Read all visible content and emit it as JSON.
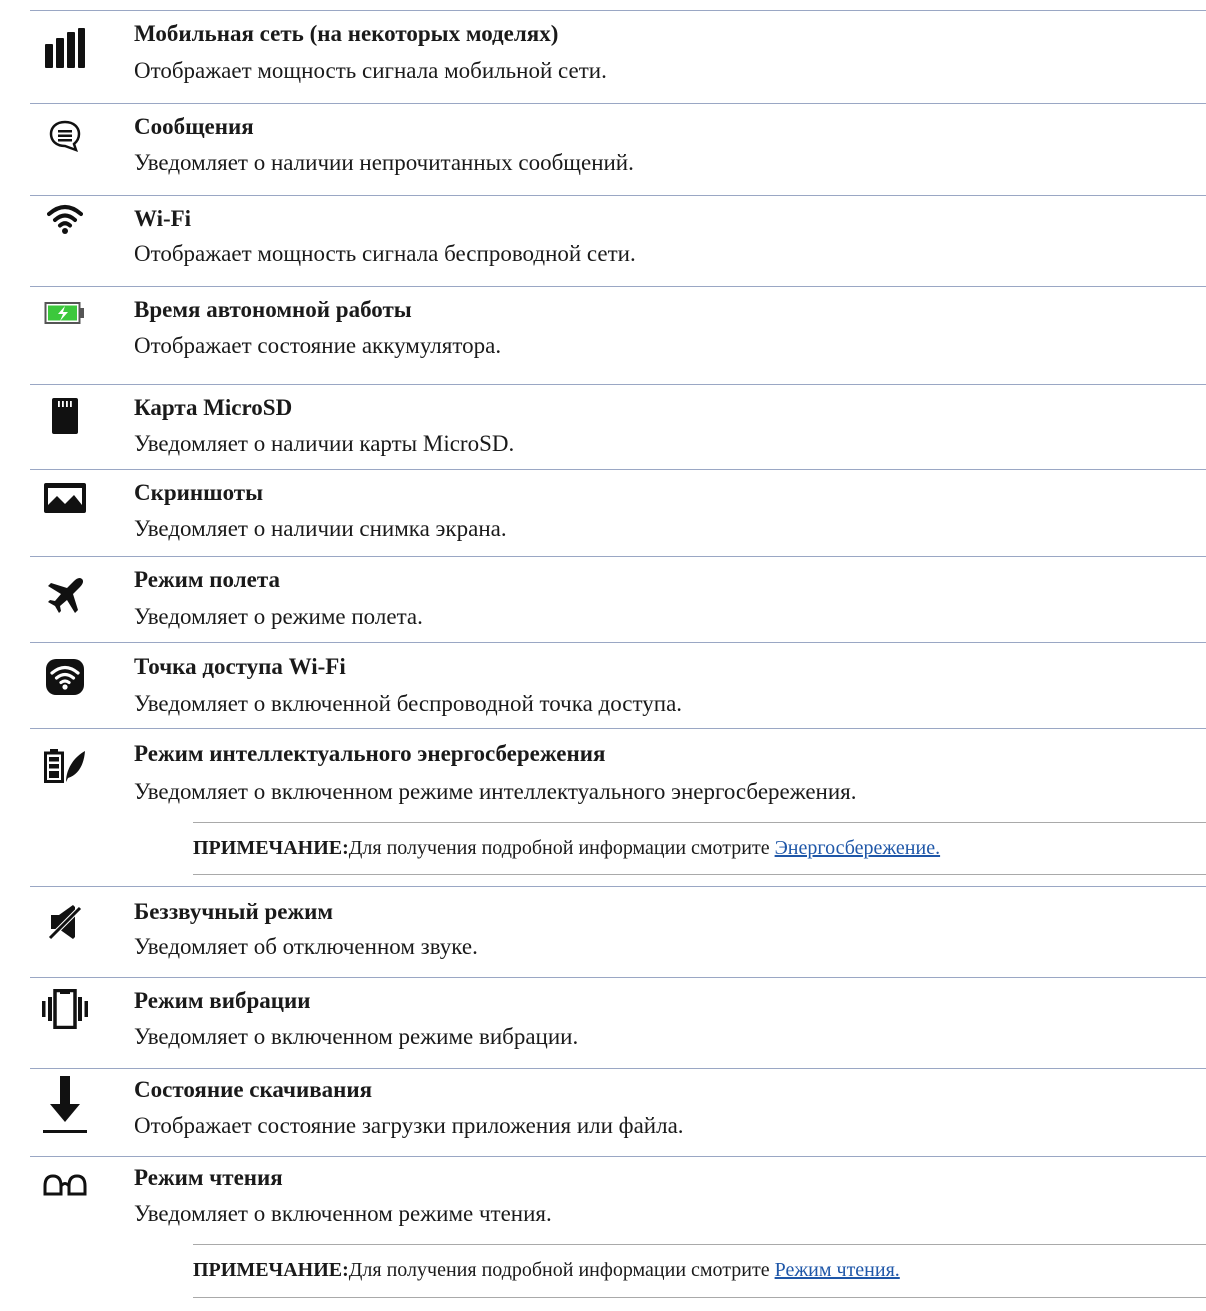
{
  "items": [
    {
      "icon": "cellular-signal-icon",
      "title": "Мобильная сеть (на некоторых моделях)",
      "desc": "Отображает мощность сигнала мобильной сети."
    },
    {
      "icon": "message-icon",
      "title": "Сообщения",
      "desc": "Уведомляет о наличии непрочитанных сообщений."
    },
    {
      "icon": "wifi-icon",
      "title": "Wi-Fi",
      "desc": "Отображает мощность сигнала беспроводной сети."
    },
    {
      "icon": "battery-charging-icon",
      "title": "Время автономной работы",
      "desc": "Отображает состояние аккумулятора."
    },
    {
      "icon": "microsd-card-icon",
      "title": "Карта MicroSD",
      "desc": "Уведомляет о наличии карты MicroSD."
    },
    {
      "icon": "screenshot-icon",
      "title": "Скриншоты",
      "desc": "Уведомляет о наличии снимка экрана."
    },
    {
      "icon": "airplane-icon",
      "title": "Режим полета",
      "desc": "Уведомляет о режиме полета."
    },
    {
      "icon": "wifi-hotspot-icon",
      "title": "Точка доступа Wi-Fi",
      "desc": "Уведомляет о включенной беспроводной точка доступа."
    },
    {
      "icon": "power-saving-icon",
      "title": "Режим интеллектуального энергосбережения",
      "desc": "Уведомляет о включенном режиме интеллектуального энергосбережения."
    },
    {
      "icon": "silent-mode-icon",
      "title": "Беззвучный режим",
      "desc": "Уведомляет об отключенном звуке."
    },
    {
      "icon": "vibration-icon",
      "title": "Режим вибрации",
      "desc": "Уведомляет о включенном режиме вибрации."
    },
    {
      "icon": "download-icon",
      "title": "Состояние скачивания",
      "desc": "Отображает состояние загрузки приложения или файла."
    },
    {
      "icon": "reading-mode-icon",
      "title": "Режим чтения",
      "desc": "Уведомляет о включенном режиме чтения."
    }
  ],
  "notes": [
    {
      "label": "ПРИМЕЧАНИЕ:",
      "text": "Для получения подробной информации смотрите ",
      "link": "Энергосбережение."
    },
    {
      "label": "ПРИМЕЧАНИЕ:",
      "text": "Для получения подробной информации смотрите ",
      "link": "Режим чтения."
    }
  ],
  "colors": {
    "rule": "#9aa7c4",
    "link": "#1f57a8",
    "battery": "#3cc83c"
  }
}
